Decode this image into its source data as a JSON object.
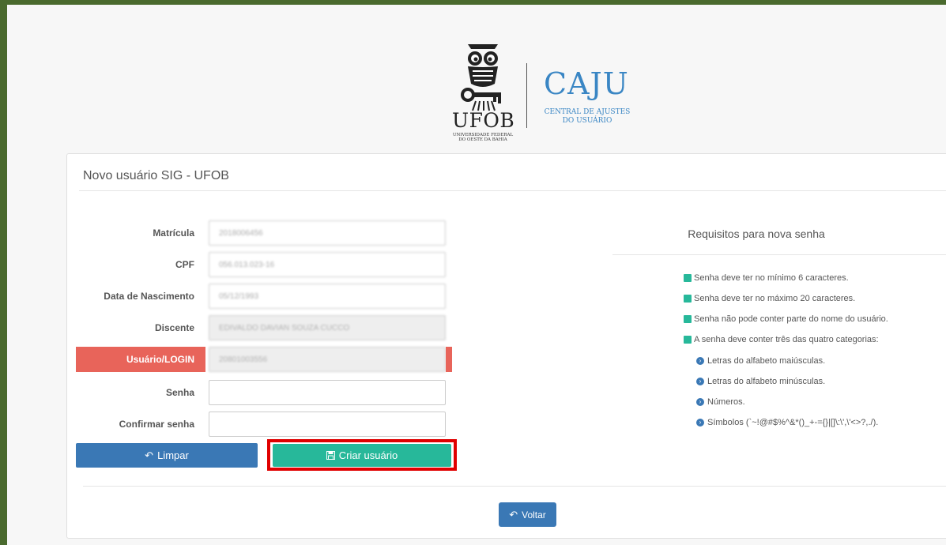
{
  "logo": {
    "ufob_word": "UFOB",
    "ufob_sub_line1": "UNIVERSIDADE FEDERAL",
    "ufob_sub_line2": "DO OESTE DA BAHIA",
    "caju_title": "CAJU",
    "caju_sub_line1": "CENTRAL DE AJUSTES",
    "caju_sub_line2": "DO USUÁRIO"
  },
  "panel": {
    "title": "Novo usuário SIG - UFOB"
  },
  "form": {
    "matricula": {
      "label": "Matrícula",
      "value": "2018006456"
    },
    "cpf": {
      "label": "CPF",
      "value": "056.013.023-16"
    },
    "nascimento": {
      "label": "Data de Nascimento",
      "value": "05/12/1993"
    },
    "discente": {
      "label": "Discente",
      "value": "EDIVALDO DAVIAN SOUZA CUCCO"
    },
    "login": {
      "label": "Usuário/LOGIN",
      "value": "20801003556"
    },
    "senha": {
      "label": "Senha",
      "value": ""
    },
    "confirmar": {
      "label": "Confirmar senha",
      "value": ""
    }
  },
  "buttons": {
    "clear_label": "Limpar",
    "create_label": "Criar usuário",
    "back_label": "Voltar"
  },
  "requirements": {
    "title": "Requisitos para nova senha",
    "items": [
      "Senha deve ter no mínimo 6 caracteres.",
      "Senha deve ter no máximo 20 caracteres.",
      "Senha não pode conter parte do nome do usuário.",
      "A senha deve conter três das quatro categorias:"
    ],
    "categories": [
      "Letras do alfabeto maiúsculas.",
      "Letras do alfabeto minúsculas.",
      "Números.",
      "Símbolos (`~!@#$%^&*()_+-={}|[]\\:\\',\\'<>?,./)."
    ]
  },
  "colors": {
    "brand_blue": "#3a78b5",
    "success_green": "#27b89a",
    "error_red": "#e8645a",
    "highlight_red": "#e00000",
    "frame_green": "#4a6a2e"
  }
}
